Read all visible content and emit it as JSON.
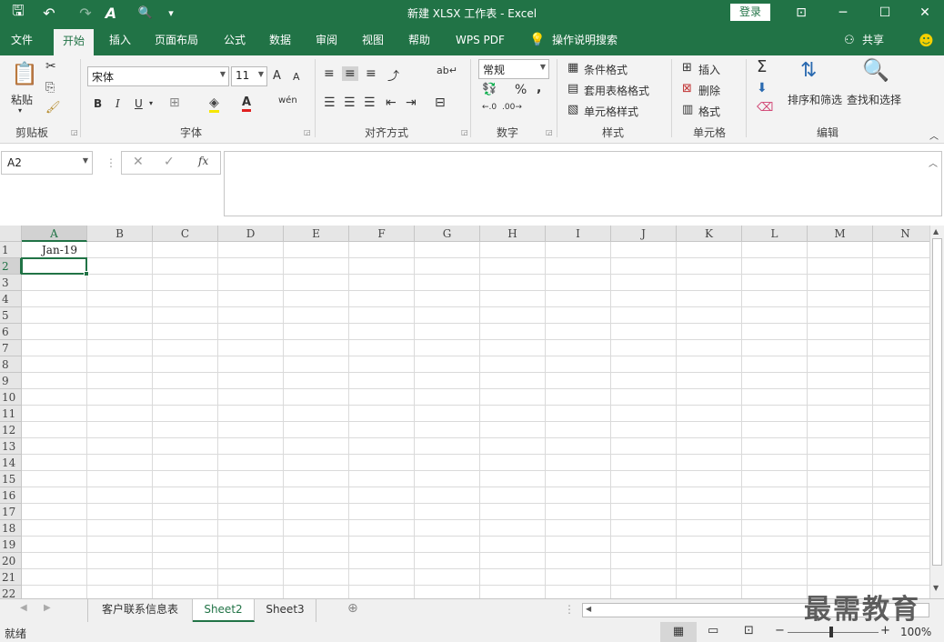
{
  "window": {
    "title": "新建 XLSX 工作表  -  Excel",
    "login_label": "登录",
    "controls": {
      "ribbon_display": "⊡",
      "minimize": "─",
      "maximize": "☐",
      "close": "✕"
    }
  },
  "qat": {
    "save": "🖫",
    "undo": "↶",
    "redo": "↷",
    "format": "A",
    "preview": "🔍",
    "customize": "▾"
  },
  "tabs": [
    "文件",
    "开始",
    "插入",
    "页面布局",
    "公式",
    "数据",
    "审阅",
    "视图",
    "帮助",
    "WPS PDF",
    "操作说明搜索"
  ],
  "active_tab": "开始",
  "share_label": "共享",
  "ribbon": {
    "clipboard": {
      "label": "剪贴板",
      "paste": "粘贴"
    },
    "font": {
      "label": "字体",
      "name": "宋体",
      "size": "11",
      "bold": "B",
      "italic": "I",
      "underline": "U",
      "grow": "A",
      "shrink": "A",
      "wen": "wén"
    },
    "alignment": {
      "label": "对齐方式"
    },
    "number": {
      "label": "数字",
      "format": "常规",
      "percent": "%",
      "comma": ","
    },
    "styles": {
      "label": "样式",
      "conditional": "条件格式",
      "table": "套用表格格式",
      "cell_styles": "单元格样式"
    },
    "cells": {
      "label": "单元格",
      "insert": "插入",
      "delete": "删除",
      "format": "格式"
    },
    "editing": {
      "label": "编辑",
      "sort_filter": "排序和筛选",
      "find_select": "查找和选择",
      "sigma": "Σ"
    }
  },
  "formula_bar": {
    "name_box": "A2",
    "fx": "fx",
    "formula": ""
  },
  "grid": {
    "columns": [
      "A",
      "B",
      "C",
      "D",
      "E",
      "F",
      "G",
      "H",
      "I",
      "J",
      "K",
      "L",
      "M",
      "N"
    ],
    "rows": [
      "1",
      "2",
      "3",
      "4",
      "5",
      "6",
      "7",
      "8",
      "9",
      "10",
      "11",
      "12",
      "13",
      "14",
      "15",
      "16",
      "17",
      "18",
      "19",
      "20",
      "21",
      "22"
    ],
    "cells": {
      "A1": "Jan-19"
    },
    "selected": "A2"
  },
  "sheets": [
    "客户联系信息表",
    "Sheet2",
    "Sheet3"
  ],
  "active_sheet": "Sheet2",
  "status": {
    "mode": "就绪",
    "zoom": "100%"
  },
  "watermark": "最需教育",
  "colors": {
    "accent": "#217346",
    "ribbon_bg": "#f3f3f3"
  }
}
